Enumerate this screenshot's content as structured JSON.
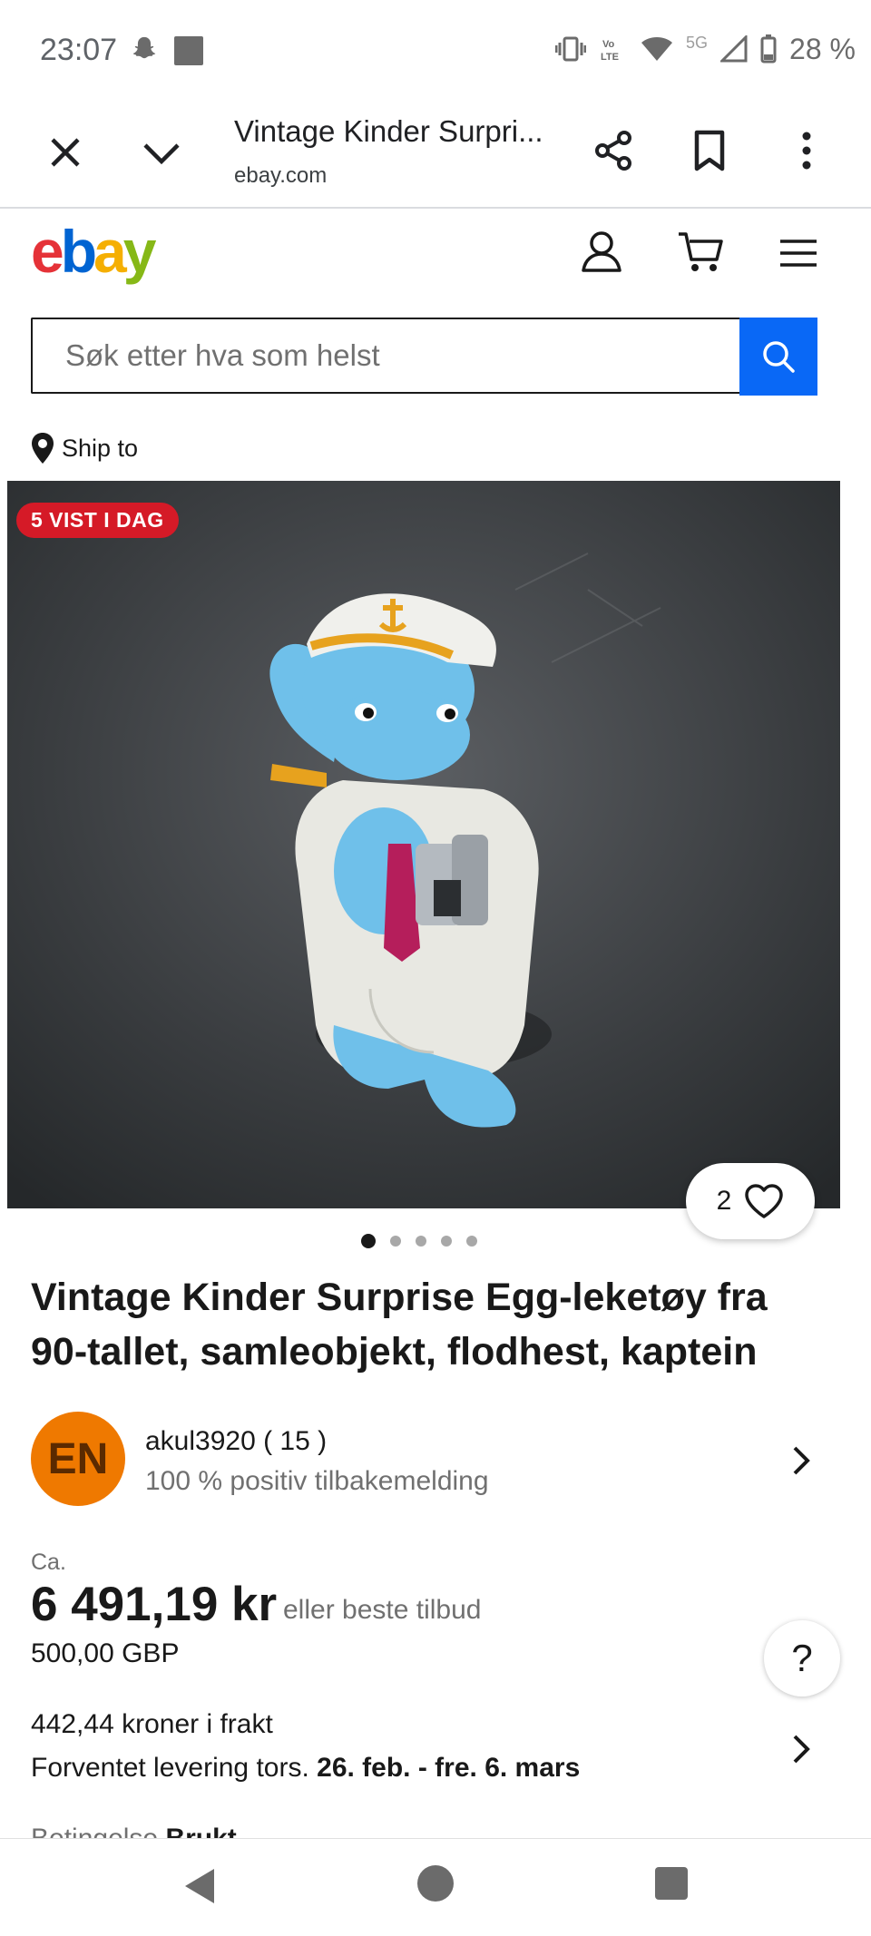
{
  "status_bar": {
    "time": "23:07",
    "network": "5G",
    "battery": "28 %"
  },
  "browser": {
    "tab_title": "Vintage Kinder Surpri...",
    "url": "ebay.com"
  },
  "header": {
    "logo": [
      "e",
      "b",
      "a",
      "y"
    ],
    "logo_colors": [
      "#e53238",
      "#0064d2",
      "#f5af02",
      "#86b817"
    ]
  },
  "search": {
    "placeholder": "Søk etter hva som helst",
    "button_color": "#0968f6"
  },
  "ship_to": {
    "label": "Ship to"
  },
  "gallery": {
    "badge": "5 VIST I DAG",
    "badge_color": "#d51a27",
    "image_count": 5,
    "active_index": 0,
    "watchers": "2"
  },
  "item": {
    "title": "Vintage Kinder Surprise Egg-leketøy fra 90-tallet, samleobjekt, flodhest, kaptein"
  },
  "seller": {
    "initials": "EN",
    "avatar_color": "#ef7900",
    "name": "akul3920 ( 15 )",
    "feedback": "100 % positiv tilbakemelding"
  },
  "price": {
    "prefix": "Ca.",
    "amount": "6 491,19 kr",
    "offer": "eller beste tilbud",
    "original": "500,00 GBP"
  },
  "help": {
    "label": "?"
  },
  "shipping": {
    "cost": "442,44 kroner i frakt",
    "delivery_label": "Forventet levering tors.",
    "delivery_dates": "26. feb. - fre. 6. mars"
  },
  "condition": {
    "label": "Betingelse",
    "value": "Brukt"
  }
}
